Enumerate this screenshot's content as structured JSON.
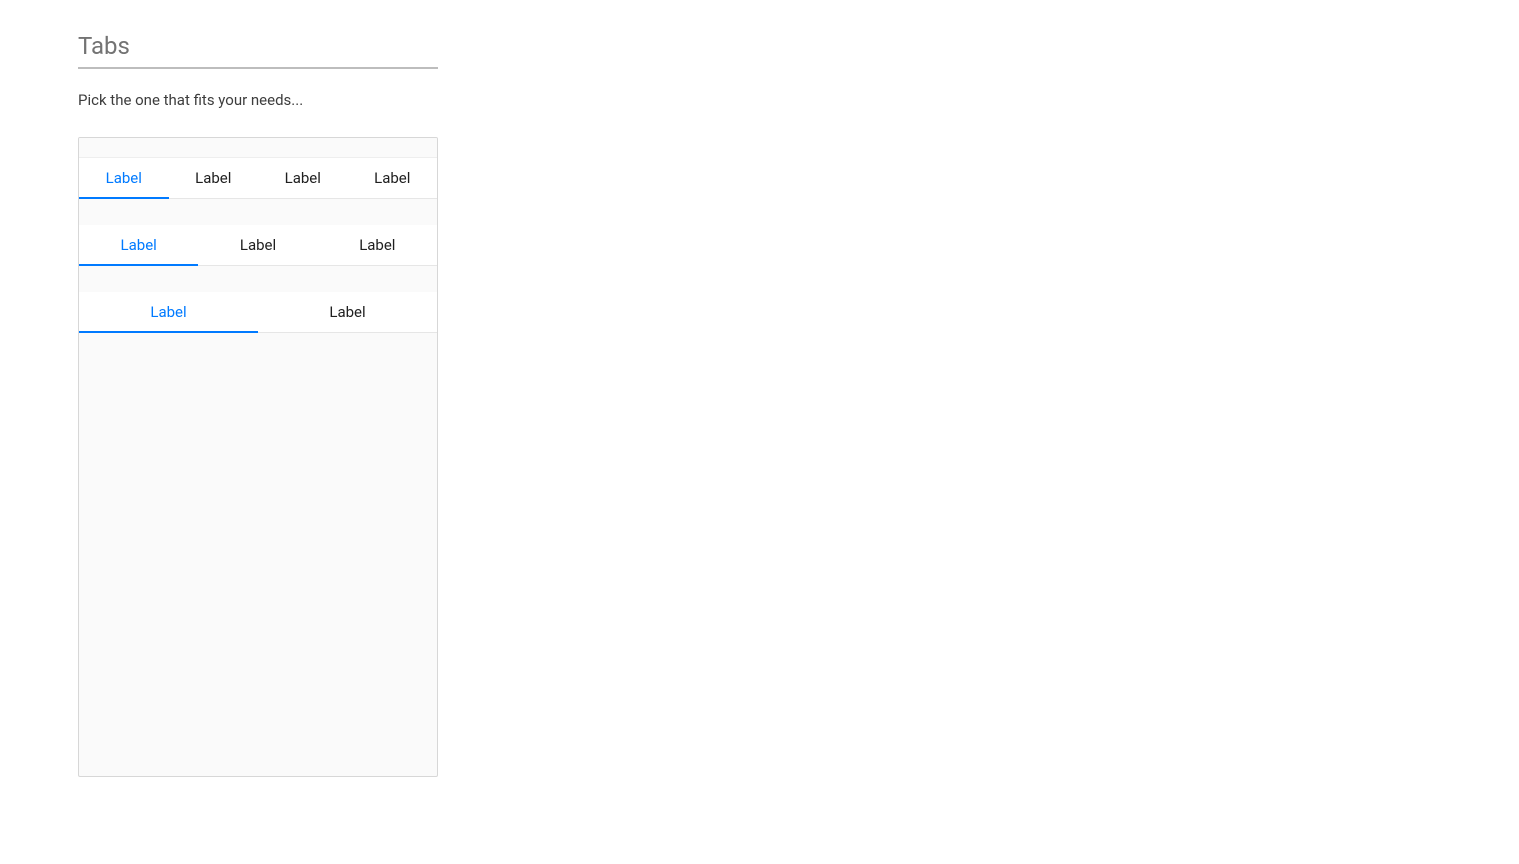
{
  "section": {
    "title": "Tabs",
    "intro": "Pick the one that fits your needs..."
  },
  "tabbars": [
    {
      "tabs": [
        "Label",
        "Label",
        "Label",
        "Label"
      ],
      "active_index": 0
    },
    {
      "tabs": [
        "Label",
        "Label",
        "Label"
      ],
      "active_index": 0
    },
    {
      "tabs": [
        "Label",
        "Label"
      ],
      "active_index": 0
    }
  ]
}
